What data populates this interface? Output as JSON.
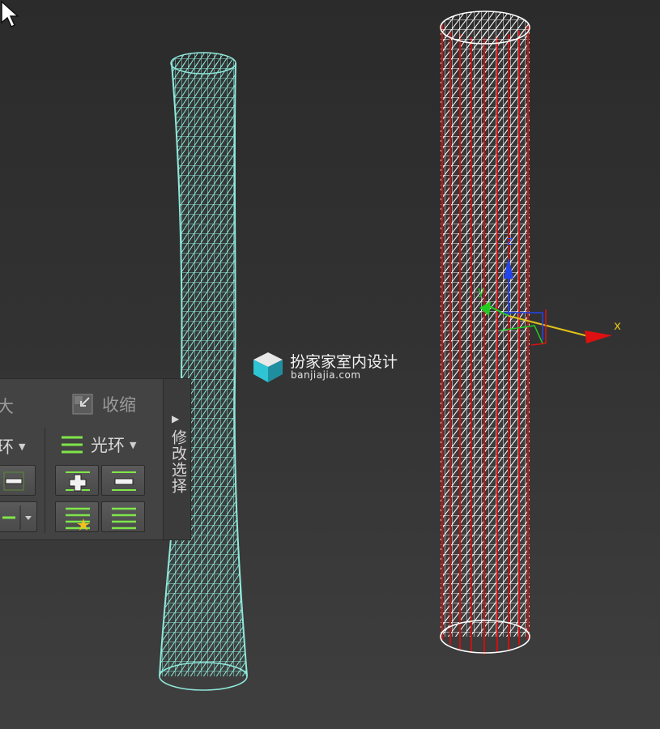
{
  "viewport": {
    "objects": [
      {
        "name": "tapered-cylinder",
        "wire_color": "#8fe8da"
      },
      {
        "name": "selected-cylinder",
        "wire_color": "#ffffff",
        "edge_color": "#cc1111"
      }
    ],
    "gizmo": {
      "x_label": "x",
      "y_label": "y",
      "z_label": "z",
      "x_color": "#e0c21a",
      "y_color": "#22cc22",
      "z_color": "#2244ee"
    }
  },
  "ribbon": {
    "row1_left_text": "大",
    "shrink_label": "收缩",
    "loop_left_text": "环",
    "ring_label": "光环",
    "vertical_tab_label": "修改选择",
    "icons": [
      "shrink-icon",
      "ring-icon",
      "ring-grow-icon",
      "ring-shrink-icon",
      "ring-select-icon",
      "ring-list-icon"
    ]
  },
  "watermark": {
    "name": "扮家家室内设计",
    "url": "banjiajia.com"
  }
}
